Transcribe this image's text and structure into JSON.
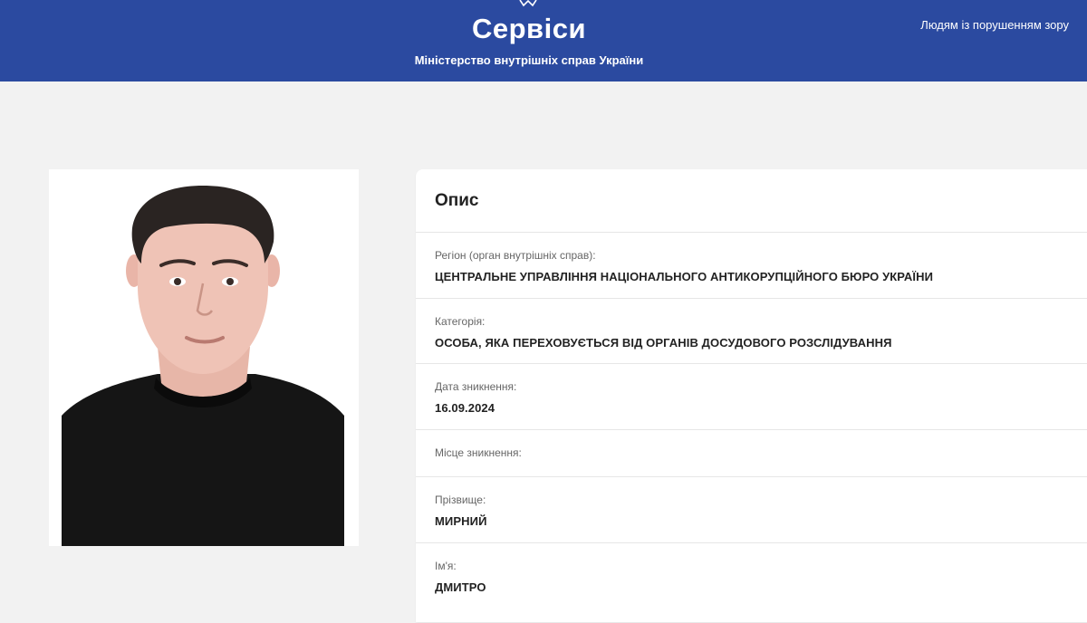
{
  "header": {
    "title": "Сервіси",
    "subtitle": "Міністерство внутрішніх справ України",
    "accessibility_link": "Людям із порушенням зору",
    "background_color": "#2b4aa0"
  },
  "card": {
    "title": "Опис",
    "fields": [
      {
        "label": "Регіон (орган внутрішніх справ):",
        "value": "ЦЕНТРАЛЬНЕ УПРАВЛІННЯ НАЦІОНАЛЬНОГО АНТИКОРУПЦІЙНОГО БЮРО УКРАЇНИ"
      },
      {
        "label": "Категорія:",
        "value": "ОСОБА, ЯКА ПЕРЕХОВУЄТЬСЯ ВІД ОРГАНІВ ДОСУДОВОГО РОЗСЛІДУВАННЯ"
      },
      {
        "label": "Дата зникнення:",
        "value": "16.09.2024"
      },
      {
        "label": "Місце зникнення:",
        "value": ""
      },
      {
        "label": "Прізвище:",
        "value": "МИРНИЙ"
      },
      {
        "label": "Ім'я:",
        "value": "ДМИТРО"
      }
    ]
  },
  "photo": {
    "icon": "person-photo"
  }
}
